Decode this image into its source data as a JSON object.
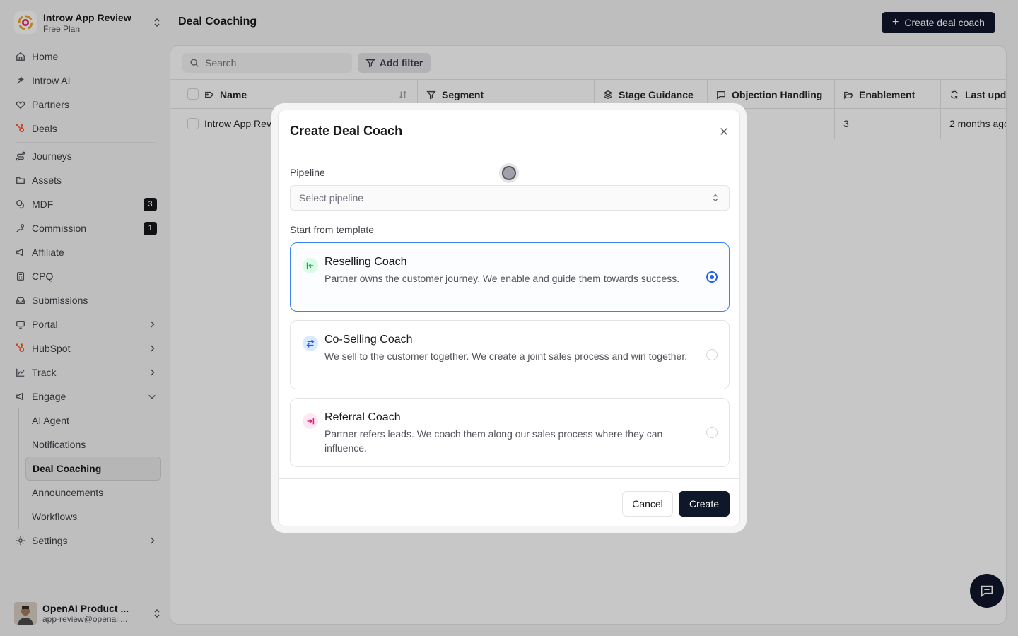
{
  "workspace": {
    "name": "Introw App Review",
    "plan": "Free Plan"
  },
  "nav": {
    "home": "Home",
    "introw_ai": "Introw AI",
    "partners": "Partners",
    "deals": "Deals",
    "journeys": "Journeys",
    "assets": "Assets",
    "mdf": "MDF",
    "mdf_badge": "3",
    "commission": "Commission",
    "commission_badge": "1",
    "affiliate": "Affiliate",
    "cpq": "CPQ",
    "submissions": "Submissions",
    "portal": "Portal",
    "hubspot": "HubSpot",
    "track": "Track",
    "engage": "Engage",
    "engage_children": {
      "ai_agent": "AI Agent",
      "notifications": "Notifications",
      "deal_coaching": "Deal Coaching",
      "announcements": "Announcements",
      "workflows": "Workflows"
    },
    "settings": "Settings"
  },
  "user": {
    "name": "OpenAI Product ...",
    "email": "app-review@openai...."
  },
  "header": {
    "title": "Deal Coaching",
    "create_button": "Create deal coach"
  },
  "toolbar": {
    "search_placeholder": "Search",
    "filter_button": "Add filter"
  },
  "table": {
    "columns": [
      "Name",
      "Segment",
      "Stage Guidance",
      "Objection Handling",
      "Enablement",
      "Last upd"
    ],
    "row": {
      "name": "Introw App Review",
      "enablement": "3",
      "last_updated": "2 months ago"
    }
  },
  "modal": {
    "title": "Create Deal Coach",
    "pipeline_label": "Pipeline",
    "pipeline_placeholder": "Select pipeline",
    "template_label": "Start from template",
    "templates": [
      {
        "title": "Reselling Coach",
        "desc": "Partner owns the customer journey. We enable and guide them towards success.",
        "selected": true
      },
      {
        "title": "Co-Selling Coach",
        "desc": "We sell to the customer together. We create a joint sales process and win together.",
        "selected": false
      },
      {
        "title": "Referral Coach",
        "desc": "Partner refers leads. We coach them along our sales process where they can influence.",
        "selected": false
      }
    ],
    "cancel": "Cancel",
    "create": "Create"
  },
  "colors": {
    "accent": "#2563eb",
    "primary_button": "#0f172a",
    "hubspot": "#ff5c35"
  }
}
